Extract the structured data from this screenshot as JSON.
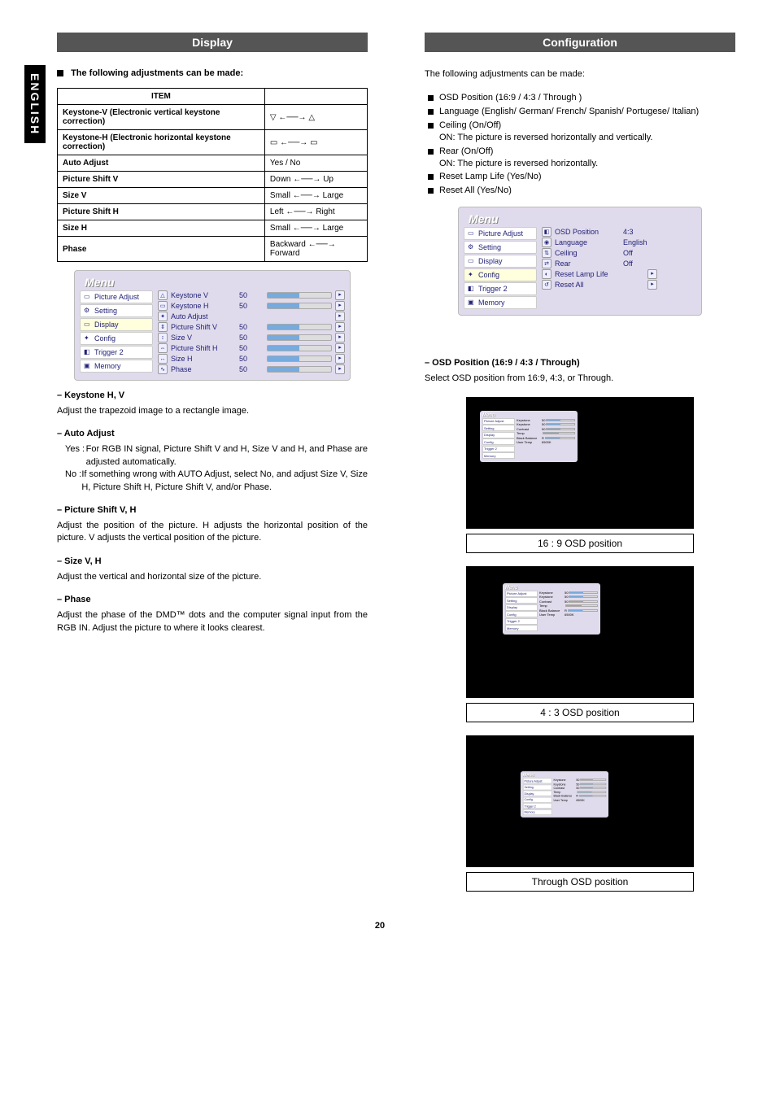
{
  "page": {
    "number": "20",
    "side_tab": "ENGLISH"
  },
  "left": {
    "header": "Display",
    "intro_prefix": "The following adjustments can be made:",
    "table": {
      "hdr_item": "ITEM",
      "rows": [
        {
          "item": "Keystone-V (Electronic vertical keystone correction)",
          "range": "▽ ←──→ △"
        },
        {
          "item": "Keystone-H (Electronic horizontal keystone correction)",
          "range": "▭ ←──→ ▭"
        },
        {
          "item": "Auto Adjust",
          "range": "Yes / No"
        },
        {
          "item": "Picture Shift V",
          "range": "Down ←──→ Up"
        },
        {
          "item": "Size V",
          "range": "Small ←──→ Large"
        },
        {
          "item": "Picture Shift H",
          "range": "Left ←──→ Right"
        },
        {
          "item": "Size H",
          "range": "Small ←──→ Large"
        },
        {
          "item": "Phase",
          "range": "Backward ←──→ Forward"
        }
      ]
    },
    "menu": {
      "title": "Menu",
      "sidebar": [
        "Picture Adjust",
        "Setting",
        "Display",
        "Config",
        "Trigger 2",
        "Memory"
      ],
      "items": [
        {
          "label": "Keystone V",
          "val": "50",
          "slider": true
        },
        {
          "label": "Keystone H",
          "val": "50",
          "slider": true
        },
        {
          "label": "Auto Adjust",
          "val": "",
          "slider": false
        },
        {
          "label": "Picture Shift V",
          "val": "50",
          "slider": true
        },
        {
          "label": "Size V",
          "val": "50",
          "slider": true
        },
        {
          "label": "Picture Shift H",
          "val": "50",
          "slider": true
        },
        {
          "label": "Size H",
          "val": "50",
          "slider": true
        },
        {
          "label": "Phase",
          "val": "50",
          "slider": true
        }
      ]
    },
    "sections": {
      "keystone_h": "– Keystone H, V",
      "keystone_t": "Adjust the trapezoid image to a rectangle image.",
      "auto_h": "– Auto Adjust",
      "auto_yes_tag": "Yes :",
      "auto_yes": "For RGB IN signal, Picture Shift V and H, Size V and H, and Phase are adjusted automatically.",
      "auto_no_tag": "No  :",
      "auto_no": "If something wrong with AUTO Adjust, select No, and adjust Size V, Size H, Picture Shift H, Picture Shift V, and/or Phase.",
      "pshift_h": "– Picture Shift V, H",
      "pshift_t": "Adjust the position of the picture. H adjusts the horizontal position of the picture. V adjusts the vertical position of the picture.",
      "size_h": "– Size V, H",
      "size_t": "Adjust the vertical and horizontal size of the picture.",
      "phase_h": "– Phase",
      "phase_t": "Adjust the phase of the DMD™ dots and the computer signal input from the RGB IN. Adjust the picture to where it looks clearest."
    }
  },
  "right": {
    "header": "Configuration",
    "intro": "The following adjustments can be made:",
    "bullets": {
      "b1": "OSD Position (16:9 / 4:3 / Through )",
      "b2": "Language (English/ German/ French/ Spanish/ Portugese/ Italian)",
      "b3a": "Ceiling (On/Off)",
      "b3b": "ON: The picture is reversed horizontally and vertically.",
      "b4a": "Rear (On/Off)",
      "b4b": "ON: The picture is reversed horizontally.",
      "b5": "Reset Lamp Life (Yes/No)",
      "b6": "Reset All (Yes/No)"
    },
    "menu": {
      "title": "Menu",
      "sidebar": [
        "Picture Adjust",
        "Setting",
        "Display",
        "Config",
        "Trigger 2",
        "Memory"
      ],
      "items": [
        {
          "label": "OSD Position",
          "val": "4:3"
        },
        {
          "label": "Language",
          "val": "English"
        },
        {
          "label": "Ceiling",
          "val": "Off"
        },
        {
          "label": "Rear",
          "val": "Off"
        },
        {
          "label": "Reset Lamp Life",
          "val": ""
        },
        {
          "label": "Reset All",
          "val": ""
        }
      ]
    },
    "osd_head": "– OSD Position (16:9 / 4:3 / Through)",
    "osd_text": "Select OSD position from 16:9, 4:3, or Through.",
    "cap_169": "16 : 9  OSD position",
    "cap_43": "4 : 3  OSD position",
    "cap_thr": "Through  OSD position"
  }
}
